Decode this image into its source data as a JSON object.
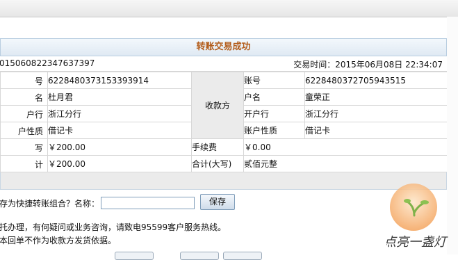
{
  "title": "转账交易成功",
  "transaction": {
    "id_partial": "015060822347637397",
    "time": "交易时间：2015年06月08日 22:34:07"
  },
  "payer": {
    "account_label": "号",
    "account_value": "6228480373153393914",
    "name_label": "名",
    "name_value": "杜月君",
    "bank_label": "户行",
    "bank_value": "浙江分行",
    "type_label": "户性质",
    "type_value": "借记卡"
  },
  "payee": {
    "section_label": "收款方",
    "account_label": "账号",
    "account_value": "6228480372705943515",
    "name_label": "户名",
    "name_value": "童荣正",
    "bank_label": "开户行",
    "bank_value": "浙江分行",
    "type_label": "账户性质",
    "type_value": "借记卡"
  },
  "amounts": {
    "amount_label": "写",
    "amount_value": "￥200.00",
    "fee_label": "手续费",
    "fee_value": "￥0.00",
    "total_label": "计",
    "total_value": "￥200.00",
    "total_cn_label": "合计(大写)",
    "total_cn_value": "贰佰元整"
  },
  "save_prompt": "存为快捷转账组合？名称：",
  "save_input_value": "",
  "save_button": "保存",
  "notes": [
    "托办理，有何疑问或业务咨询，请致电95599客户服务热线。",
    "本回单不作为收款方发货依据。"
  ],
  "watermark_text": "点亮一盏灯",
  "colors": {
    "title": "#b35c1a",
    "panel_bg": "#ebebeb",
    "header_bg": "#dfe9f3",
    "border": "#d7d7d7"
  }
}
